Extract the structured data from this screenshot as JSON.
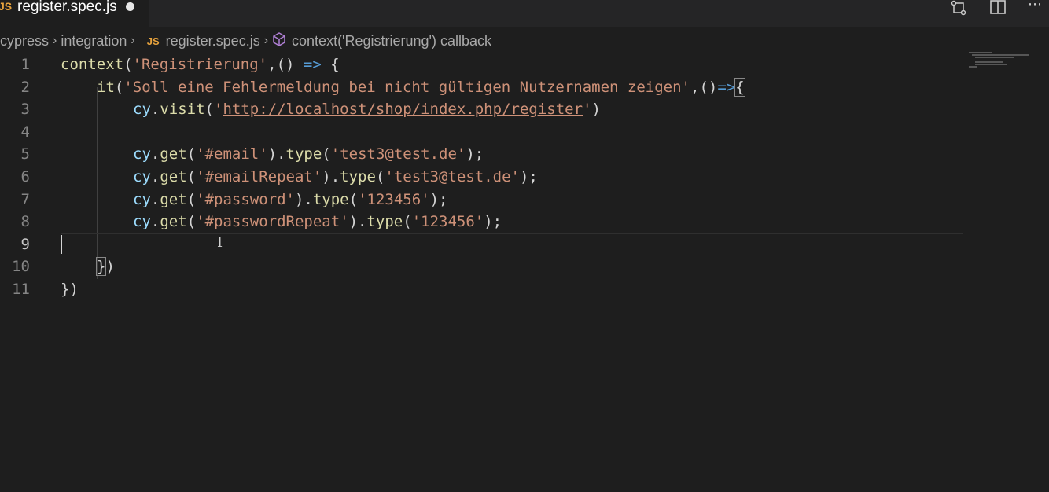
{
  "tab": {
    "icon": "JS",
    "filename": "register.spec.js",
    "unsaved": true
  },
  "toolbar": {
    "icons": [
      "source-control-icon",
      "split-editor-icon",
      "more-actions-icon"
    ]
  },
  "breadcrumbs": {
    "items": [
      "cypress",
      "integration",
      "register.spec.js",
      "context('Registrierung') callback"
    ],
    "file_icon": "JS"
  },
  "editor": {
    "line_numbers": [
      "1",
      "2",
      "3",
      "4",
      "5",
      "6",
      "7",
      "8",
      "9",
      "10",
      "11"
    ],
    "lines": {
      "l1": {
        "fn": "context",
        "p1": "(",
        "str": "'Registrierung'",
        "p2": ",() ",
        "arrow": "=>",
        "p3": " {"
      },
      "l2": {
        "fn": "it",
        "p1": "(",
        "str": "'Soll eine Fehlermeldung bei nicht gültigen Nutzernamen zeigen'",
        "p2": ",()",
        "arrow": "=>",
        "p3": "{"
      },
      "l3": {
        "obj": "cy",
        "dot": ".",
        "fn": "visit",
        "p1": "(",
        "q1": "'",
        "url": "http://localhost/shop/index.php/register",
        "q2": "'",
        "p2": ")"
      },
      "l5": {
        "obj": "cy",
        "dot": ".",
        "fn": "get",
        "p1": "(",
        "sel": "'#email'",
        "p2": ").",
        "fn2": "type",
        "p3": "(",
        "val": "'test3@test.de'",
        "p4": ");"
      },
      "l6": {
        "obj": "cy",
        "dot": ".",
        "fn": "get",
        "p1": "(",
        "sel": "'#emailRepeat'",
        "p2": ").",
        "fn2": "type",
        "p3": "(",
        "val": "'test3@test.de'",
        "p4": ");"
      },
      "l7": {
        "obj": "cy",
        "dot": ".",
        "fn": "get",
        "p1": "(",
        "sel": "'#password'",
        "p2": ").",
        "fn2": "type",
        "p3": "(",
        "val": "'123456'",
        "p4": ");"
      },
      "l8": {
        "obj": "cy",
        "dot": ".",
        "fn": "get",
        "p1": "(",
        "sel": "'#passwordRepeat'",
        "p2": ").",
        "fn2": "type",
        "p3": "(",
        "val": "'123456'",
        "p4": ");"
      },
      "l10": {
        "b": "}",
        "p": ")"
      },
      "l11": {
        "text": "})"
      }
    }
  },
  "colors": {
    "background": "#1e1e1e",
    "function": "#dcdcaa",
    "string": "#ce9178",
    "keyword": "#569cd6",
    "variable": "#9cdcfe",
    "js_icon": "#e8a33d"
  }
}
